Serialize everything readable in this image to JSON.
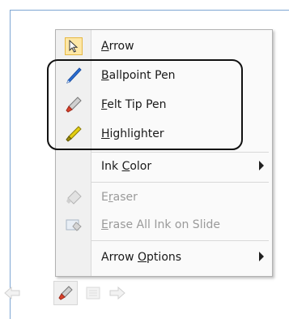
{
  "menu": {
    "items": [
      {
        "label": "Arrow",
        "accel": "A",
        "rest": "rrow",
        "icon": "arrow-pointer-icon",
        "disabled": false
      },
      {
        "label": "Ballpoint Pen",
        "accel": "B",
        "rest": "allpoint Pen",
        "icon": "ballpoint-pen-icon",
        "disabled": false
      },
      {
        "label": "Felt Tip Pen",
        "accel": "F",
        "rest": "elt Tip Pen",
        "icon": "felt-tip-pen-icon",
        "disabled": false
      },
      {
        "label": "Highlighter",
        "accel": "H",
        "rest": "ighlighter",
        "icon": "highlighter-icon",
        "disabled": false
      },
      {
        "label": "Ink Color",
        "pre": "Ink ",
        "accel": "C",
        "rest": "olor",
        "submenu": true,
        "disabled": false
      },
      {
        "label": "Eraser",
        "pre": "E",
        "accel": "r",
        "rest": "aser",
        "icon": "eraser-icon",
        "disabled": true
      },
      {
        "label": "Erase All Ink on Slide",
        "accel": "E",
        "rest": "rase All Ink on Slide",
        "icon": "erase-all-ink-icon",
        "disabled": true
      },
      {
        "label": "Arrow Options",
        "pre": "Arrow ",
        "accel": "O",
        "rest": "ptions",
        "submenu": true,
        "disabled": false
      }
    ]
  },
  "colors": {
    "ballpoint": "#2a6fd6",
    "felt": "#d9412b",
    "highlighter": "#e4cf12",
    "selected_bg": "#fde7a6"
  }
}
